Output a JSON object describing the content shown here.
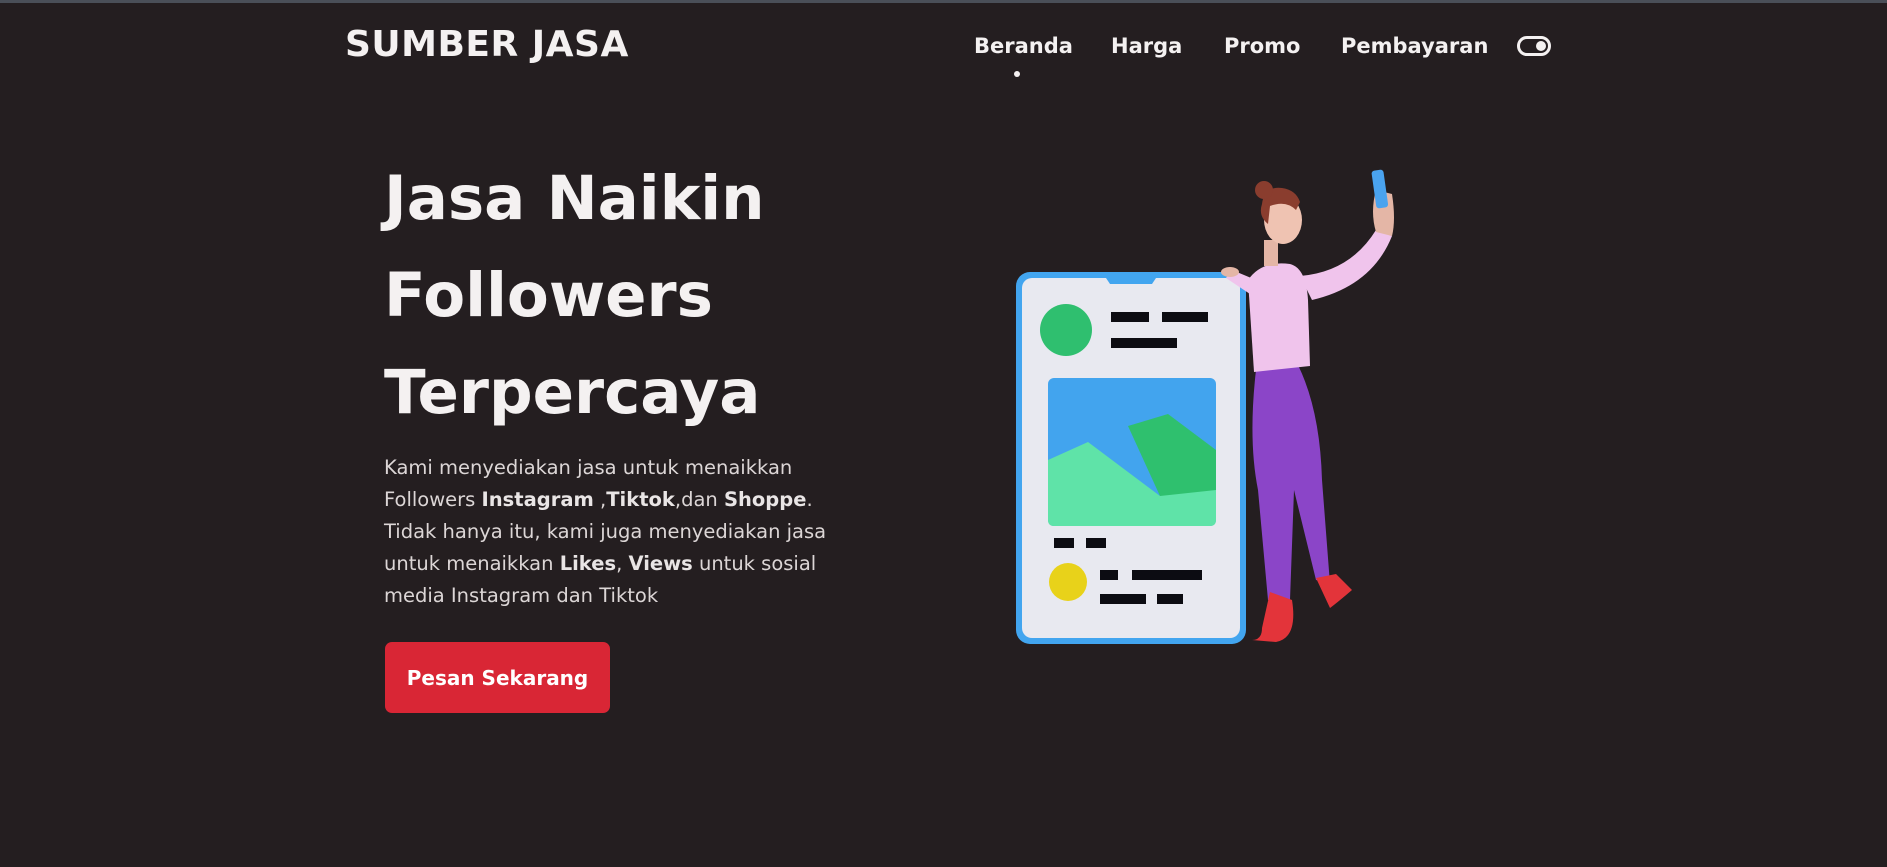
{
  "header": {
    "logo": "SUMBER JASA",
    "nav": [
      {
        "label": "Beranda",
        "active": true
      },
      {
        "label": "Harga"
      },
      {
        "label": "Promo"
      },
      {
        "label": "Pembayaran"
      }
    ],
    "theme_toggle_icon": "toggle-icon"
  },
  "hero": {
    "title_lines": [
      "Jasa Naikin",
      "Followers",
      "Terpercaya"
    ],
    "desc": {
      "t1": "Kami menyediakan jasa untuk menaikkan Followers ",
      "b1": "Instagram",
      "t2": " ,",
      "b2": "Tiktok",
      "t3": ",dan ",
      "b3": "Shoppe",
      "t4": ". Tidak hanya itu, kami juga menyediakan jasa untuk menaikkan ",
      "b4": "Likes",
      "t5": ", ",
      "b5": "Views",
      "t6": " untuk sosial media Instagram dan Tiktok"
    },
    "cta_label": "Pesan Sekarang",
    "illustration_icon": "phone-woman-selfie-illustration"
  },
  "colors": {
    "background": "#241e20",
    "text": "#f4f1f1",
    "accent": "#d92635",
    "phone_frame": "#42a5ef",
    "phone_screen": "#e8e9f0"
  }
}
